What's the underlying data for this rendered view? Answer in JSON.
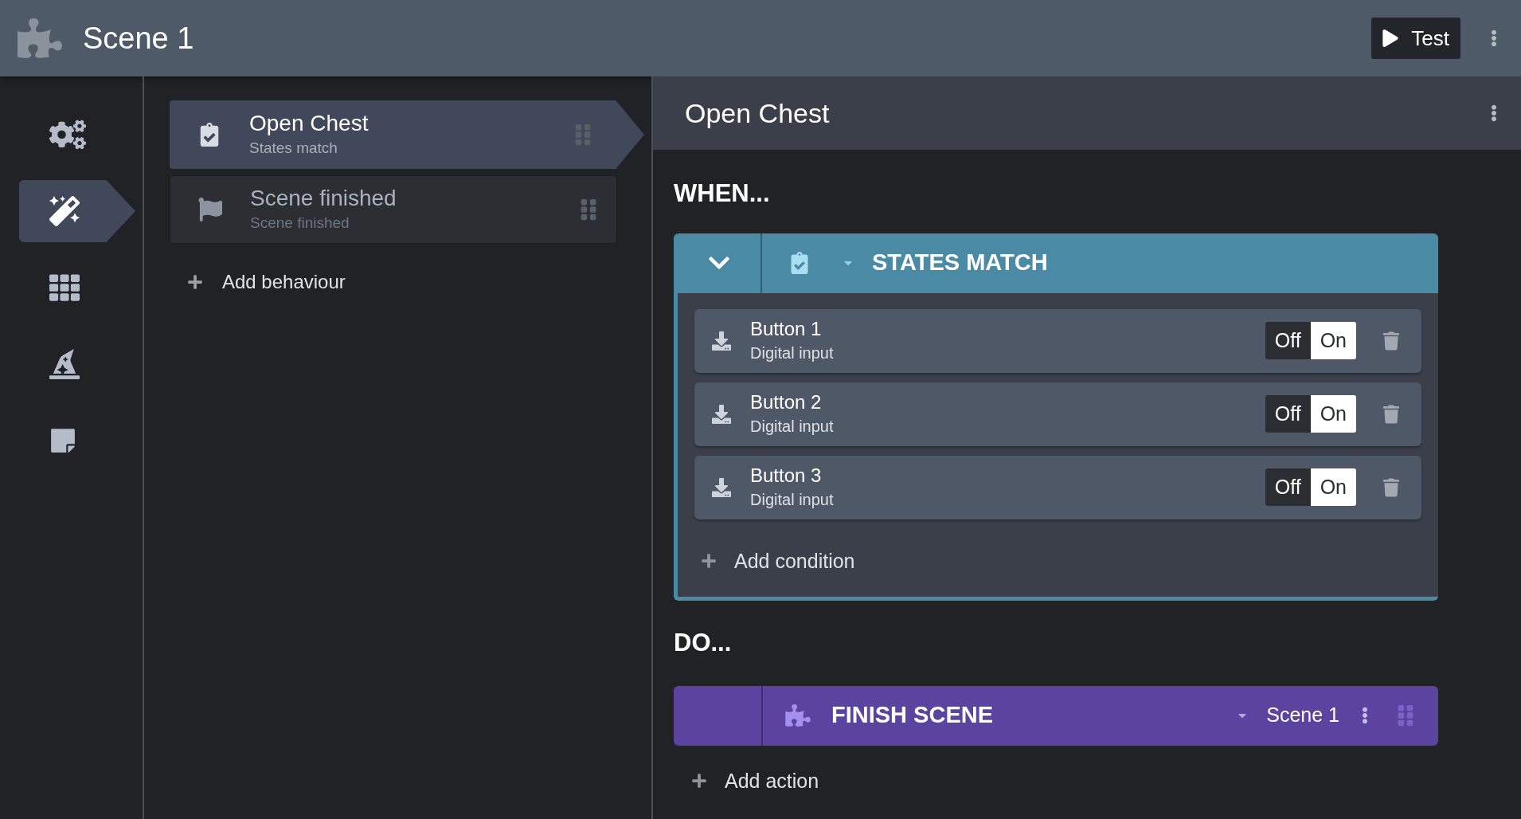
{
  "topbar": {
    "title": "Scene 1",
    "test_button": "Test"
  },
  "nav": [
    {
      "kind": "gears",
      "selected": false
    },
    {
      "kind": "wand",
      "selected": true
    },
    {
      "kind": "grid",
      "selected": false
    },
    {
      "kind": "hat",
      "selected": false
    },
    {
      "kind": "note",
      "selected": false
    }
  ],
  "behaviours": [
    {
      "kind": "states",
      "title": "Open Chest",
      "subtitle": "States match",
      "selected": true
    },
    {
      "kind": "flag",
      "title": "Scene finished",
      "subtitle": "Scene finished",
      "selected": false
    }
  ],
  "add_behaviour": "Add behaviour",
  "detail": {
    "title": "Open Chest",
    "when_label": "WHEN...",
    "condition_block": {
      "title": "STATES MATCH",
      "expanded": true,
      "conditions": [
        {
          "name": "Button 1",
          "type": "Digital input",
          "options": [
            {
              "label": "Off",
              "selected": false
            },
            {
              "label": "On",
              "selected": true
            }
          ]
        },
        {
          "name": "Button 2",
          "type": "Digital input",
          "options": [
            {
              "label": "Off",
              "selected": false
            },
            {
              "label": "On",
              "selected": true
            }
          ]
        },
        {
          "name": "Button 3",
          "type": "Digital input",
          "options": [
            {
              "label": "Off",
              "selected": false
            },
            {
              "label": "On",
              "selected": true
            }
          ]
        }
      ],
      "add_condition": "Add condition"
    },
    "do_label": "DO...",
    "actions": [
      {
        "title": "FINISH SCENE",
        "value": "Scene 1"
      }
    ],
    "add_action": "Add action"
  }
}
